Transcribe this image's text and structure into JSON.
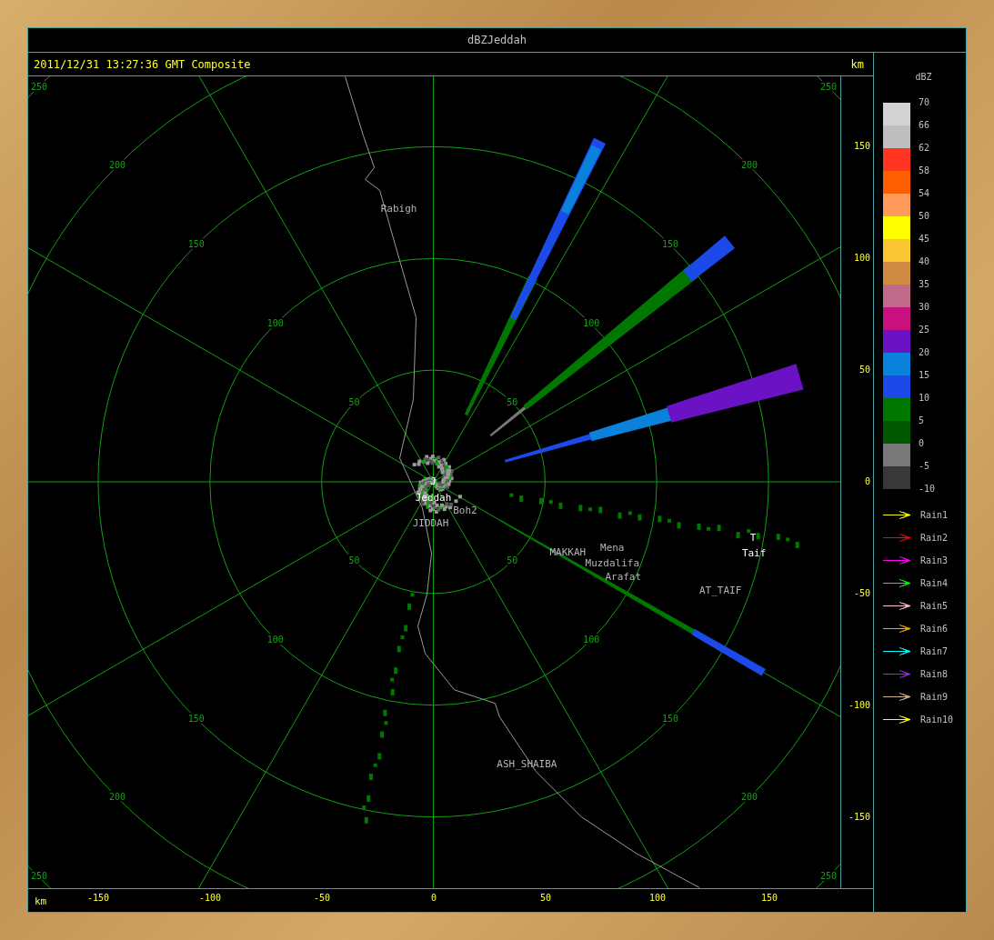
{
  "window": {
    "title": "dBZJeddah"
  },
  "header": {
    "timestamp": "2011/12/31 13:27:36 GMT Composite",
    "unit": "km"
  },
  "plot": {
    "rings": [
      {
        "labels": [
          "50",
          "50",
          "50",
          "50"
        ]
      },
      {
        "labels": [
          "100",
          "100",
          "100",
          "100"
        ]
      },
      {
        "labels": [
          "150",
          "150",
          "150",
          "150"
        ]
      },
      {
        "labels": [
          "200",
          "200",
          "200",
          "200"
        ]
      },
      {
        "labels": [
          "250",
          "250",
          "250",
          "250"
        ]
      }
    ],
    "places": [
      {
        "kind": "place",
        "label": "Rabigh"
      },
      {
        "kind": "site",
        "label": "J"
      },
      {
        "kind": "site",
        "label": "Jeddah"
      },
      {
        "kind": "place",
        "label": "Boh2"
      },
      {
        "kind": "place",
        "label": "JIDDAH"
      },
      {
        "kind": "place",
        "label": "MAKKAH"
      },
      {
        "kind": "place",
        "label": "Mena"
      },
      {
        "kind": "place",
        "label": "Muzdalifa"
      },
      {
        "kind": "place",
        "label": "Arafat"
      },
      {
        "kind": "site",
        "label": "T"
      },
      {
        "kind": "site",
        "label": "Taif"
      },
      {
        "kind": "place",
        "label": "AT_TAIF"
      },
      {
        "kind": "place",
        "label": "ASH_SHAIBA"
      }
    ],
    "y_axis": {
      "ticks": [
        "150",
        "100",
        "50",
        "0",
        "-50",
        "-100",
        "-150"
      ]
    },
    "x_axis": {
      "unit": "km",
      "ticks": [
        "-150",
        "-100",
        "-50",
        "0",
        "50",
        "100",
        "150"
      ]
    }
  },
  "legend": {
    "title": "dBZ",
    "bins": [
      {
        "color": "#d3d3d3"
      },
      {
        "color": "#bebebe"
      },
      {
        "color": "#ff3522"
      },
      {
        "color": "#ff5f00"
      },
      {
        "color": "#ff9a5a"
      },
      {
        "color": "#ffff00"
      },
      {
        "color": "#fbc634"
      },
      {
        "color": "#cd8a40"
      },
      {
        "color": "#bf6a88"
      },
      {
        "color": "#c8107e"
      },
      {
        "color": "#6a12c4"
      },
      {
        "color": "#0a82dc"
      },
      {
        "color": "#1b4ae8"
      },
      {
        "color": "#007800"
      },
      {
        "color": "#005800"
      },
      {
        "color": "#787878"
      },
      {
        "color": "#383838"
      }
    ],
    "ticks": [
      "70",
      "66",
      "62",
      "58",
      "54",
      "50",
      "45",
      "40",
      "35",
      "30",
      "25",
      "20",
      "15",
      "10",
      "5",
      "0",
      "-5",
      "-10"
    ],
    "arrows": [
      {
        "label": "Rain1",
        "color": "#ffff00"
      },
      {
        "label": "Rain2",
        "color": "#ff0000"
      },
      {
        "label": "Rain3",
        "color": "#ff00ff"
      },
      {
        "label": "Rain4",
        "color": "#00ff00"
      },
      {
        "label": "Rain5",
        "color": "#ffc0cb"
      },
      {
        "label": "Rain6",
        "color": "#ffa500"
      },
      {
        "label": "Rain7",
        "color": "#00ffff"
      },
      {
        "label": "Rain8",
        "color": "#a020f0"
      },
      {
        "label": "Rain9",
        "color": "#d2b48c"
      },
      {
        "label": "Rain10",
        "color": "#ffff00"
      }
    ]
  }
}
